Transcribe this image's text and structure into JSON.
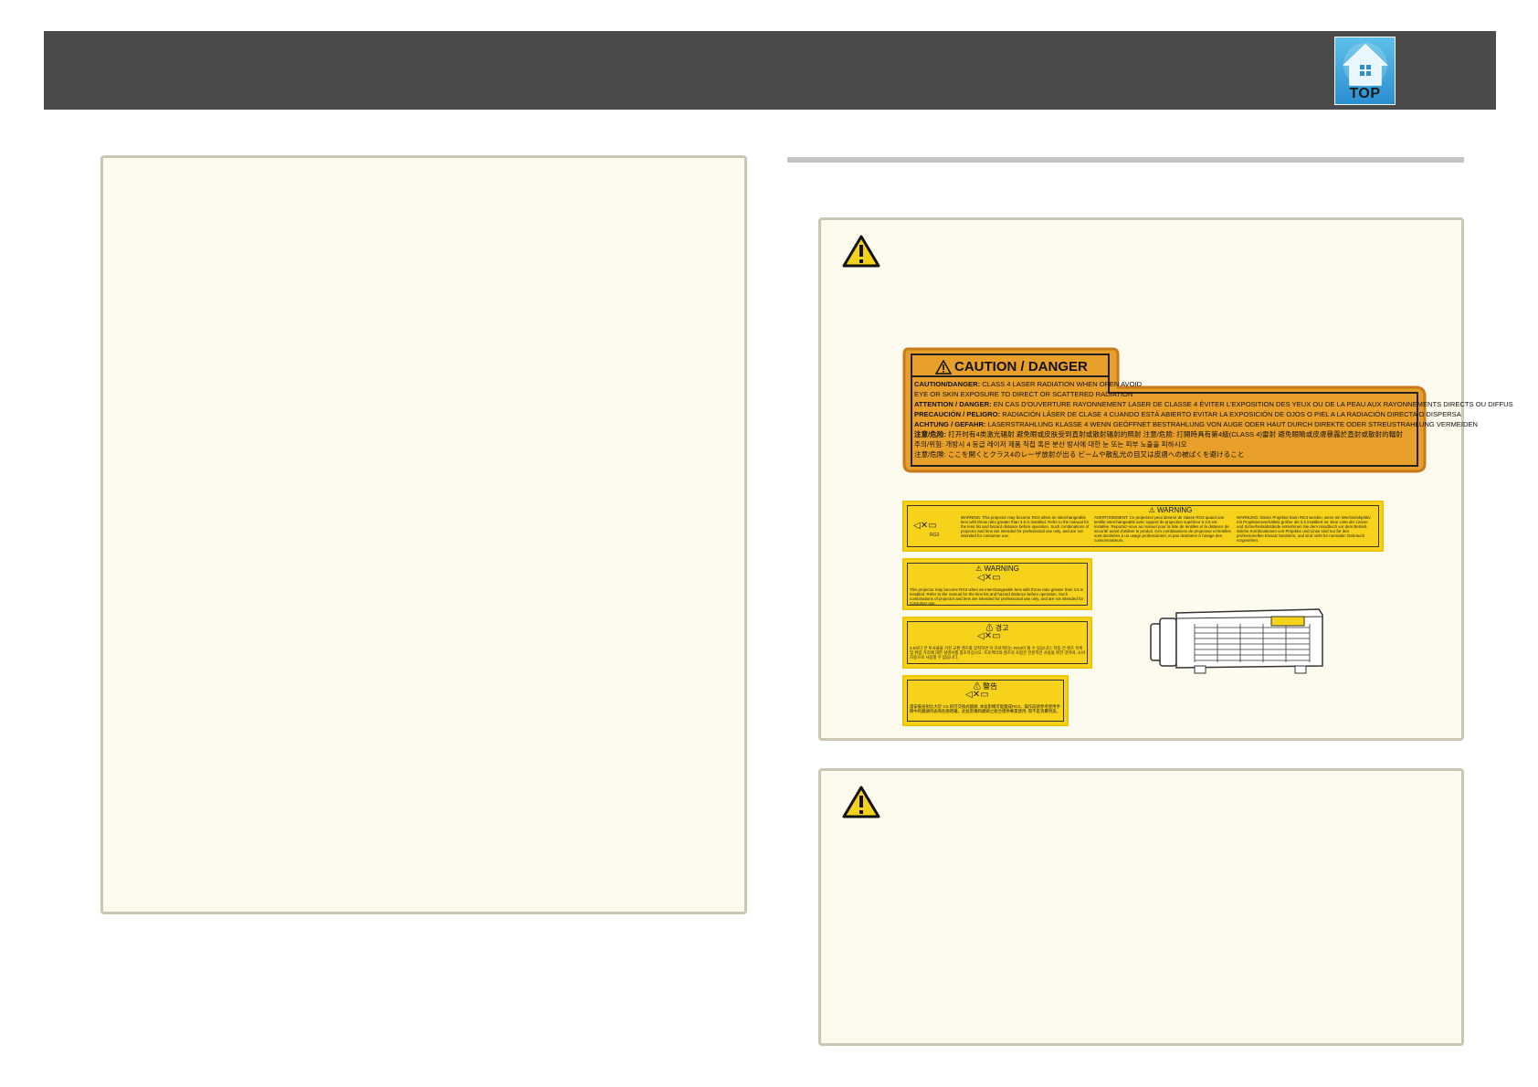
{
  "header": {
    "top_button_label": "TOP",
    "icon": "home-icon"
  },
  "caution_label": {
    "title": "CAUTION / DANGER",
    "lines": [
      {
        "key": "CAUTION/DANGER:",
        "text": " CLASS 4 LASER RADIATION WHEN OPEN AVOID"
      },
      {
        "key": "",
        "text": "EYE OR SKIN EXPOSURE TO DIRECT OR SCATTERED RADIATION"
      },
      {
        "key": "ATTENTION / DANGER:",
        "text": " EN CAS D'OUVERTURE RAYONNEMENT LASER DE CLASSE 4 ÉVITER L'EXPOSITION DES YEUX OU DE LA PEAU AUX RAYONNEMENTS DIRECTS OU DIFFUS"
      },
      {
        "key": "PRECAUCIÓN / PELIGRO:",
        "text": " RADIACIÓN LÁSER DE CLASE 4 CUANDO ESTÁ ABIERTO EVITAR LA EXPOSICIÓN DE OJOS O PIEL A LA RADIACIÓN DIRECTA O DISPERSA"
      },
      {
        "key": "ACHTUNG / GEFAHR:",
        "text": " LASERSTRAHLUNG KLASSE 4 WENN GEÖFFNET BESTRAHLUNG VON AUGE ODER HAUT DURCH DIREKTE ODER STREUSTRAHLUNG VERMEIDEN"
      },
      {
        "key": "注意/危险:",
        "text": " 打开时有4类激光辐射 避免眼或皮肤受到直射或散射辐射的照射        注意/危險: 打開時具有第4級(CLASS 4)雷射 避免眼睛或皮膚暴露於直射或散射的輻射"
      },
      {
        "key": "",
        "text": "주의/위험: 개방시 4 등급 레이저 제품 직접 혹은 분산 방사에 대한 눈 또는 피부 노출을 피하시오"
      },
      {
        "key": "",
        "text": "注意/危険: ここを開くとクラス4のレーザ放射が出る ビームや散乱光の目又は皮膚への被ばくを避けること"
      }
    ]
  },
  "warning_wide": {
    "title": "⚠ WARNING",
    "columns": [
      "WARNING: This projector may become RG3 when an interchangeable lens with throw ratio greater than 3.5 is installed. Refer to the manual for the lens list and hazard distance before operation. Such combinations of projector and lens are intended for professional use only, and are not intended for consumer use.",
      "AVERTISSEMENT: Ce projecteur peut devenir de classe RG3 quand une lentille interchangeable avec rapport de projection supérieur à 3.5 est installée. Reportez-vous au manuel pour la liste de lentilles et la distance de sécurité avant d'utiliser le produit. Ces combinaisons de projecteur et lentilles sont destinées à un usage professionnel, et pas destinées à l'usage des consommateurs.",
      "WARNUNG: Dieser Projektor kann RG3 werden, wenn ein Wechselobjektiv mit Projektionsverhältnis größer als 3.5 installiert ist. Eine Liste der Linsen und Sicherheitsabstände entnehmen Sie dem Handbuch vor dem Betrieb. Solche Kombinationen von Projektor und Linse sind nur für den professionellen Einsatz bestimmt, und sind nicht für normalen Gebrauch vorgesehen."
    ]
  },
  "warning_en": {
    "title": "⚠ WARNING",
    "text": "This projector may become RG3 when an interchangeable lens with throw ratio greater than 3.5 is installed. Refer to the manual for the lens list and hazard distance before operation. Such combinations of projector and lens are intended for professional use only, and are not intended for consumer use."
  },
  "warning_ko": {
    "title": "⚠ 경고",
    "text": "3.5보다 큰 투사율을 가진 교환 렌즈를 장착하면 이 프로젝터는 RG3이 될 수 있습니다. 작동 전 렌즈 목록 및 위험 거리에 대한 설명서를 참조하십시오. 프로젝터와 렌즈의 조합은 전문적인 사용을 위한 것이며, 소비자용으로 사용할 수 없습니다."
  },
  "warning_zh": {
    "title": "⚠ 警告",
    "text": "當安裝投射比大於 3.5 的可交換式鏡頭, 本投影機可能變成RG3。操作前請參考使用手冊中的鏡頭列表和危險距離。此投影機和鏡頭之組合僅供專業使用, 而不是消費用途。"
  },
  "symbols": {
    "rg": "RG3",
    "beam_glyph": "◁✕▭"
  }
}
